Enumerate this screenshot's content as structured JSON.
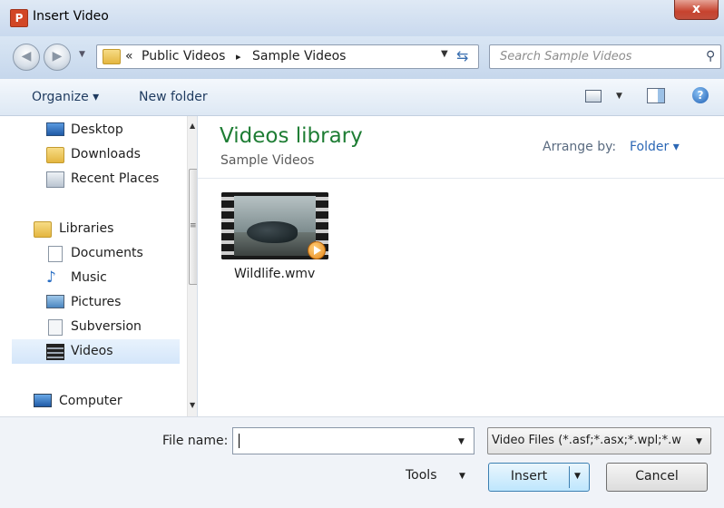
{
  "window": {
    "title": "Insert Video",
    "app_icon": "P",
    "close": "x"
  },
  "address": {
    "crumb_prefix": "«",
    "crumbs": [
      "Public Videos",
      "Sample Videos"
    ],
    "separator": "▸",
    "search_placeholder": "Search Sample Videos"
  },
  "toolbar": {
    "organize": "Organize ▾",
    "new_folder": "New folder"
  },
  "nav": {
    "items": [
      {
        "label": "Desktop",
        "icon": "desktop-icon"
      },
      {
        "label": "Downloads",
        "icon": "downloads-icon"
      },
      {
        "label": "Recent Places",
        "icon": "recent-places-icon"
      },
      {
        "label": "Libraries",
        "icon": "libraries-icon"
      },
      {
        "label": "Documents",
        "icon": "documents-icon"
      },
      {
        "label": "Music",
        "icon": "music-icon"
      },
      {
        "label": "Pictures",
        "icon": "pictures-icon"
      },
      {
        "label": "Subversion",
        "icon": "subversion-icon"
      },
      {
        "label": "Videos",
        "icon": "videos-icon",
        "selected": true
      },
      {
        "label": "Computer",
        "icon": "computer-icon"
      }
    ]
  },
  "content": {
    "library_title": "Videos library",
    "library_subtitle": "Sample Videos",
    "arrange_label": "Arrange by:",
    "arrange_value": "Folder ▾",
    "files": [
      {
        "name": "Wildlife.wmv",
        "icon": "video-thumbnail"
      }
    ]
  },
  "footer": {
    "file_name_label": "File name:",
    "file_name_value": "",
    "file_type": "Video Files (*.asf;*.asx;*.wpl;*.w",
    "tools": "Tools",
    "insert": "Insert",
    "cancel": "Cancel"
  },
  "colors": {
    "accent_title": "#1e7d34",
    "link": "#2b67b5",
    "selection": "#d4e6fa"
  }
}
